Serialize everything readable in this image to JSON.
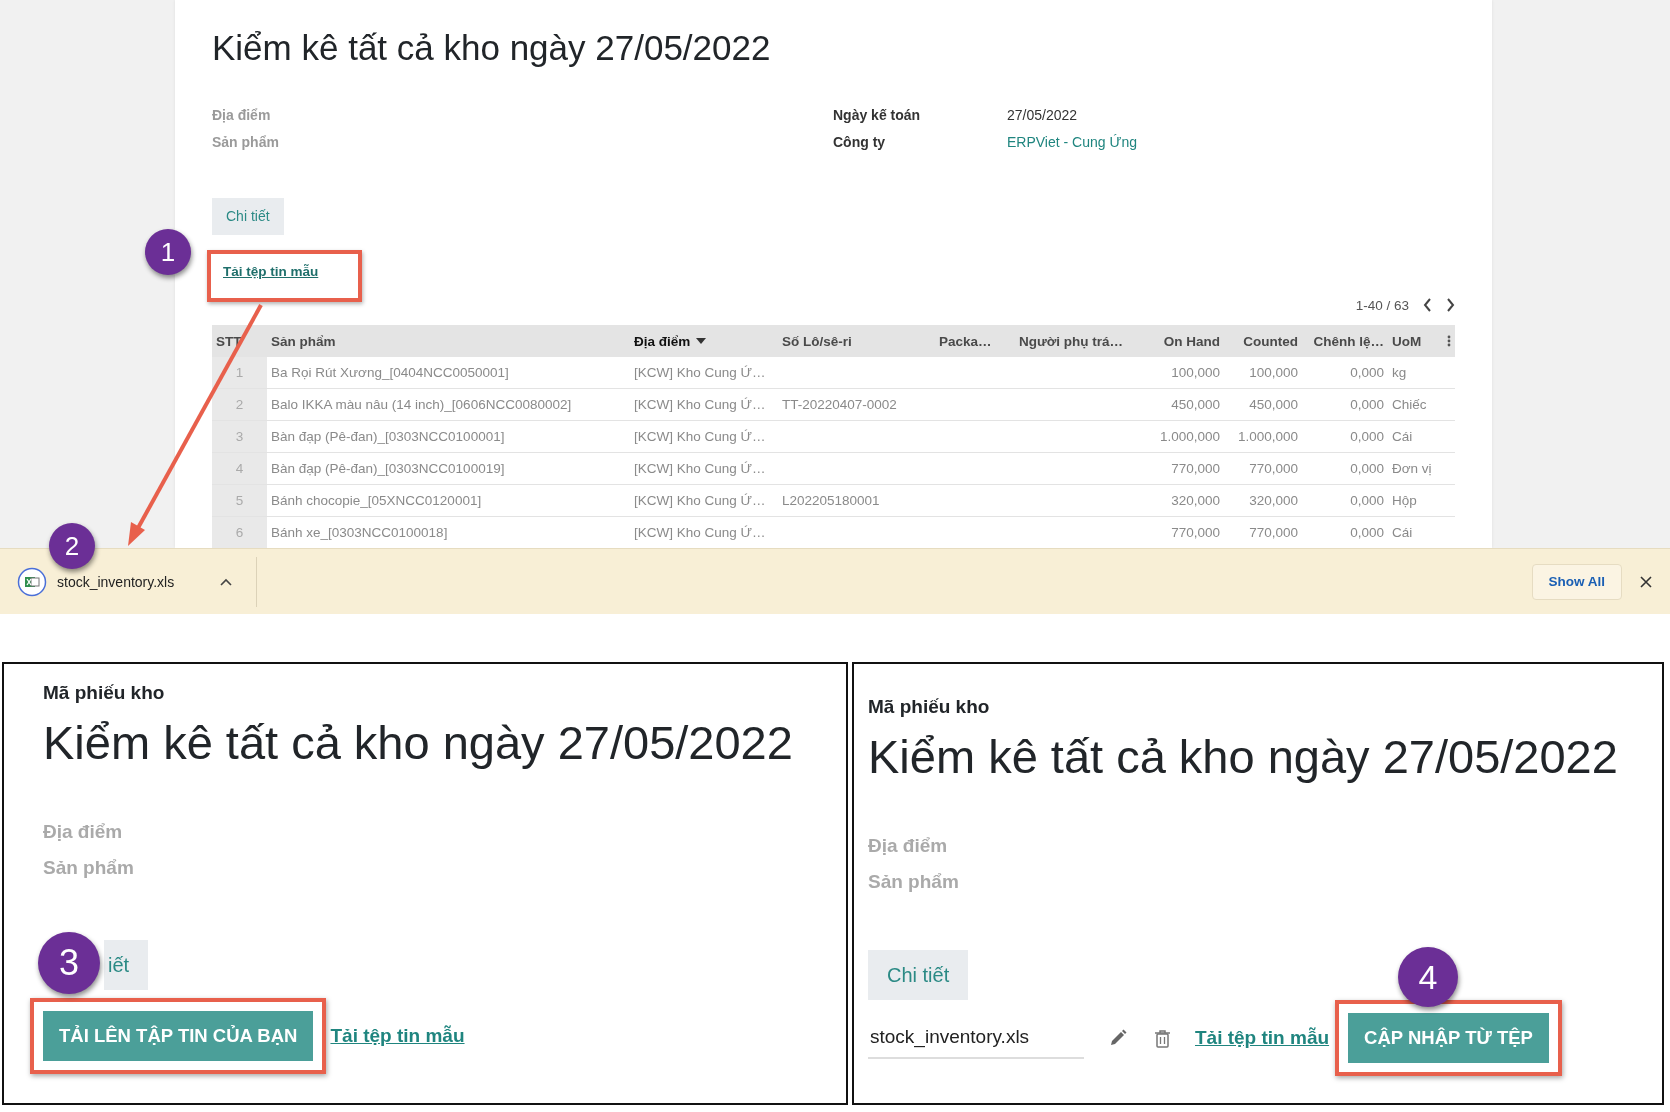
{
  "form": {
    "title": "Kiểm kê tất cả kho ngày 27/05/2022",
    "left_fields": [
      {
        "label": "Địa điểm"
      },
      {
        "label": "Sản phẩm"
      }
    ],
    "right_fields": [
      {
        "label": "Ngày kế toán",
        "value": "27/05/2022",
        "kind": "text"
      },
      {
        "label": "Công ty",
        "value": "ERPViet - Cung Ứng",
        "kind": "link"
      }
    ],
    "tab": "Chi tiết",
    "template_link": "Tải tệp tin mẫu",
    "pager": "1-40 / 63",
    "table": {
      "columns": [
        {
          "label": "STT",
          "sorted": false
        },
        {
          "label": "Sản phẩm",
          "sorted": false
        },
        {
          "label": "Địa điểm",
          "sorted": true
        },
        {
          "label": "Số Lô/sê-ri",
          "sorted": false
        },
        {
          "label": "Packa…",
          "sorted": false
        },
        {
          "label": "Người phụ trá…",
          "sorted": false
        },
        {
          "label": "On Hand",
          "sorted": false
        },
        {
          "label": "Counted",
          "sorted": false
        },
        {
          "label": "Chênh lệ…",
          "sorted": false
        },
        {
          "label": "UoM",
          "sorted": false
        }
      ],
      "rows": [
        {
          "no": "1",
          "product": "Ba Rọi Rút Xương_[0404NCC0050001]",
          "location": "[KCW] Kho Cung Ứ…",
          "on_hand": "100,000",
          "counted": "100,000",
          "difference": "0,000",
          "uom": "kg"
        },
        {
          "no": "2",
          "product": "Balo IKKA màu nâu (14 inch)_[0606NCC0080002]",
          "location": "[KCW] Kho Cung Ứ…",
          "lot": "TT-20220407-0002",
          "on_hand": "450,000",
          "counted": "450,000",
          "difference": "0,000",
          "uom": "Chiếc"
        },
        {
          "no": "3",
          "product": "Bàn đạp (Pê-đan)_[0303NCC0100001]",
          "location": "[KCW] Kho Cung Ứ…",
          "on_hand": "1.000,000",
          "counted": "1.000,000",
          "difference": "0,000",
          "uom": "Cái"
        },
        {
          "no": "4",
          "product": "Bàn đạp (Pê-đan)_[0303NCC0100019]",
          "location": "[KCW] Kho Cung Ứ…",
          "on_hand": "770,000",
          "counted": "770,000",
          "difference": "0,000",
          "uom": "Đơn vị"
        },
        {
          "no": "5",
          "product": "Bánh chocopie_[05XNCC0120001]",
          "location": "[KCW] Kho Cung Ứ…",
          "lot": "L202205180001",
          "on_hand": "320,000",
          "counted": "320,000",
          "difference": "0,000",
          "uom": "Hộp"
        },
        {
          "no": "6",
          "product": "Bánh xe_[0303NCC0100018]",
          "location": "[KCW] Kho Cung Ứ…",
          "on_hand": "770,000",
          "counted": "770,000",
          "difference": "0,000",
          "uom": "Cái"
        }
      ]
    }
  },
  "download_bar": {
    "file_name": "stock_inventory.xls",
    "show_all": "Show All"
  },
  "panels": [
    {
      "kind": "upload",
      "caption": "Mã phiếu kho",
      "title": "Kiểm kê tất cả kho ngày 27/05/2022",
      "fields": [
        "Địa điểm",
        "Sản phẩm"
      ],
      "tab": "iết",
      "button": "TẢI LÊN TẬP TIN CỦA BẠN",
      "template_link": "Tải tệp tin mẫu"
    },
    {
      "kind": "update",
      "caption": "Mã phiếu kho",
      "title": "Kiểm kê tất cả kho ngày 27/05/2022",
      "fields": [
        "Địa điểm",
        "Sản phẩm"
      ],
      "tab": "Chi tiết",
      "file_name": "stock_inventory.xls",
      "template_link": "Tải tệp tin mẫu",
      "button": "CẬP NHẬP TỪ TỆP"
    }
  ],
  "steps": [
    {
      "number": "1"
    },
    {
      "number": "2"
    },
    {
      "number": "3"
    },
    {
      "number": "4"
    }
  ]
}
